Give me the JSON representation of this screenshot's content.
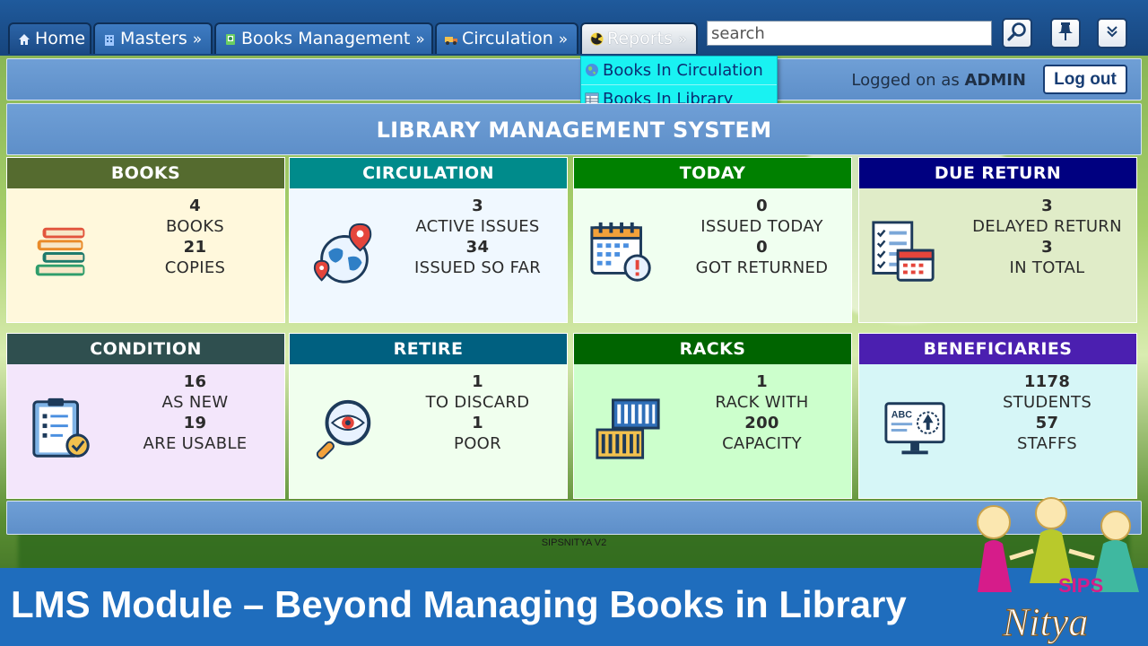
{
  "nav": {
    "tabs": [
      {
        "label": "Home",
        "icon": "home-icon"
      },
      {
        "label": "Masters",
        "icon": "building-icon"
      },
      {
        "label": "Books Management",
        "icon": "book-icon"
      },
      {
        "label": "Circulation",
        "icon": "truck-icon"
      },
      {
        "label": "Reports",
        "icon": "radiation-icon"
      }
    ],
    "arrow": "»",
    "search_placeholder": "search"
  },
  "reports_menu": {
    "items": [
      {
        "label": "Books In Circulation",
        "icon": "globe-icon"
      },
      {
        "label": "Books In Library",
        "icon": "table-icon"
      }
    ]
  },
  "session": {
    "prefix": "Logged on as",
    "user": "ADMIN",
    "logout_label": "Log out"
  },
  "page_title": "LIBRARY MANAGEMENT SYSTEM",
  "cards": [
    {
      "title": "BOOKS",
      "head_color": "#556b2f",
      "body_color": "#fff8dc",
      "icon": "books-stack-icon",
      "n1": "4",
      "l1": "BOOKS",
      "n2": "21",
      "l2": "COPIES"
    },
    {
      "title": "CIRCULATION",
      "head_color": "#008b8b",
      "body_color": "#f0f8ff",
      "icon": "world-map-pin-icon",
      "n1": "3",
      "l1": "ACTIVE ISSUES",
      "n2": "34",
      "l2": "ISSUED SO FAR"
    },
    {
      "title": "TODAY",
      "head_color": "#008000",
      "body_color": "#f0fff0",
      "icon": "calendar-alert-icon",
      "n1": "0",
      "l1": "ISSUED TODAY",
      "n2": "0",
      "l2": "GOT RETURNED"
    },
    {
      "title": "DUE RETURN",
      "head_color": "#000080",
      "body_color": "#e0ecc8",
      "icon": "checklist-calendar-icon",
      "n1": "3",
      "l1": "DELAYED RETURN",
      "n2": "3",
      "l2": "IN TOTAL"
    },
    {
      "title": "CONDITION",
      "head_color": "#2f4f4f",
      "body_color": "#f3e6fb",
      "icon": "clipboard-check-icon",
      "n1": "16",
      "l1": "AS NEW",
      "n2": "19",
      "l2": "ARE USABLE"
    },
    {
      "title": "RETIRE",
      "head_color": "#006080",
      "body_color": "#f0ffee",
      "icon": "magnifier-eye-icon",
      "n1": "1",
      "l1": "TO DISCARD",
      "n2": "1",
      "l2": "POOR"
    },
    {
      "title": "RACKS",
      "head_color": "#006400",
      "body_color": "#ccffcc",
      "icon": "containers-icon",
      "n1": "1",
      "l1": "RACK WITH",
      "n2": "200",
      "l2": "CAPACITY"
    },
    {
      "title": "BENEFICIARIES",
      "head_color": "#4b1fb0",
      "body_color": "#d6f6f7",
      "icon": "monitor-abc-icon",
      "n1": "1178",
      "l1": "STUDENTS",
      "n2": "57",
      "l2": "STAFFS"
    }
  ],
  "version": "SIPSNITYA V2",
  "banner": {
    "text": "LMS Module – Beyond Managing Books in Library"
  },
  "logo": {
    "word1": "SIPS",
    "word2": "Nitya"
  }
}
